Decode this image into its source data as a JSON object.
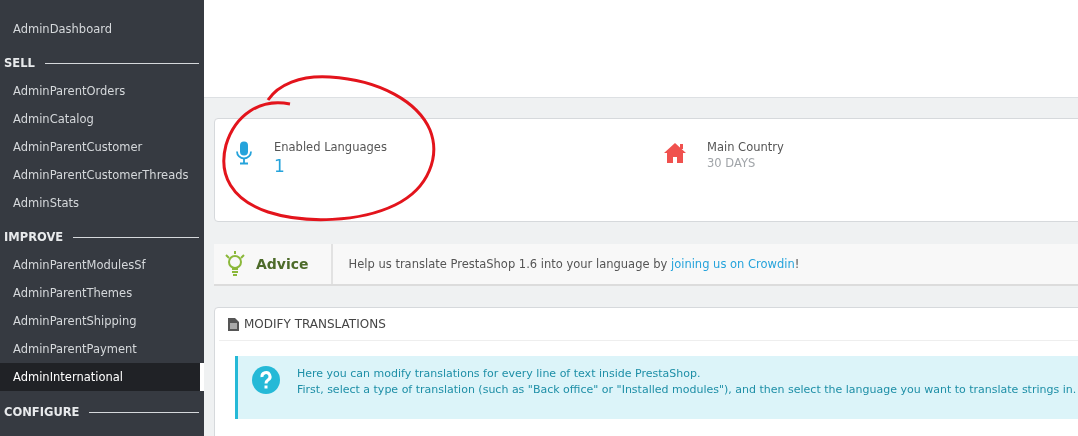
{
  "sidebar": {
    "items": [
      {
        "kind": "link",
        "label": "AdminDashboard",
        "selected": false
      },
      {
        "kind": "heading",
        "label": "SELL"
      },
      {
        "kind": "link",
        "label": "AdminParentOrders",
        "selected": false
      },
      {
        "kind": "link",
        "label": "AdminCatalog",
        "selected": false
      },
      {
        "kind": "link",
        "label": "AdminParentCustomer",
        "selected": false
      },
      {
        "kind": "link",
        "label": "AdminParentCustomerThreads",
        "selected": false
      },
      {
        "kind": "link",
        "label": "AdminStats",
        "selected": false
      },
      {
        "kind": "heading",
        "label": "IMPROVE"
      },
      {
        "kind": "link",
        "label": "AdminParentModulesSf",
        "selected": false
      },
      {
        "kind": "link",
        "label": "AdminParentThemes",
        "selected": false
      },
      {
        "kind": "link",
        "label": "AdminParentShipping",
        "selected": false
      },
      {
        "kind": "link",
        "label": "AdminParentPayment",
        "selected": false
      },
      {
        "kind": "link",
        "label": "AdminInternational",
        "selected": true
      },
      {
        "kind": "heading",
        "label": "CONFIGURE"
      }
    ]
  },
  "kpis": [
    {
      "kind": "microphone",
      "label": "Enabled Languages",
      "value": "1"
    },
    {
      "kind": "house",
      "label": "Main Country",
      "value": "30 DAYS"
    }
  ],
  "advice": {
    "title": "Advice",
    "text": "Help us translate PrestaShop 1.6 into your language by ",
    "link": "joining us on Crowdin",
    "after": "!"
  },
  "panel": {
    "title": "MODIFY TRANSLATIONS",
    "info": [
      "Here you can modify translations for every line of text inside PrestaShop.",
      "First, select a type of translation (such as \"Back office\" or \"Installed modules\"), and then select the language you want to translate strings in."
    ]
  },
  "annotation": {
    "kind": "ellipse",
    "color": "#e3141c"
  }
}
